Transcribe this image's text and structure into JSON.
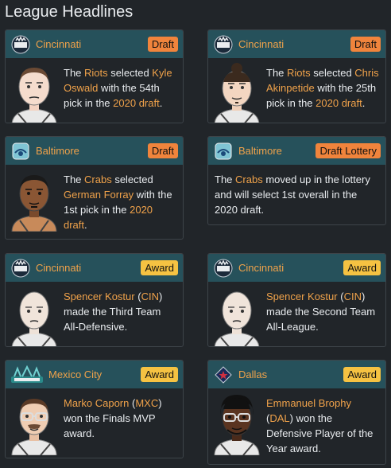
{
  "page": {
    "title": "League Headlines"
  },
  "cards": [
    {
      "team": "Cincinnati",
      "badge": "Draft",
      "badge_type": "draft",
      "logo": "riots-logo",
      "parts": [
        "The ",
        "Riots",
        " selected ",
        "Kyle Oswald",
        " with the 54th pick in the ",
        "2020 draft",
        "."
      ]
    },
    {
      "team": "Cincinnati",
      "badge": "Draft",
      "badge_type": "draft",
      "logo": "riots-logo",
      "parts": [
        "The ",
        "Riots",
        " selected ",
        "Chris Akinpetide",
        " with the 25th pick in the ",
        "2020 draft",
        "."
      ]
    },
    {
      "team": "Baltimore",
      "badge": "Draft",
      "badge_type": "draft",
      "logo": "crabs-logo",
      "parts": [
        "The ",
        "Crabs",
        " selected ",
        "German Forray",
        " with the 1st pick in the ",
        "2020 draft",
        "."
      ]
    },
    {
      "team": "Baltimore",
      "badge": "Draft Lottery",
      "badge_type": "draft",
      "logo": "crabs-logo",
      "parts": [
        "The ",
        "Crabs",
        " moved up in the lottery and will select 1st overall in the 2020 draft."
      ]
    },
    {
      "team": "Cincinnati",
      "badge": "Award",
      "badge_type": "award",
      "logo": "riots-logo",
      "parts": [
        "Spencer Kostur",
        " (",
        "CIN",
        ") made the Third Team All-Defensive."
      ]
    },
    {
      "team": "Cincinnati",
      "badge": "Award",
      "badge_type": "award",
      "logo": "riots-logo",
      "parts": [
        "Spencer Kostur",
        " (",
        "CIN",
        ") made the Second Team All-League."
      ]
    },
    {
      "team": "Mexico City",
      "badge": "Award",
      "badge_type": "award",
      "logo": "aztecs-logo",
      "parts": [
        "Marko Caporn",
        " (",
        "MXC",
        ") won the Finals MVP award."
      ]
    },
    {
      "team": "Dallas",
      "badge": "Award",
      "badge_type": "award",
      "logo": "dallas-logo",
      "parts": [
        "Emmanuel Brophy",
        " (",
        "DAL",
        ") won the Defensive Player of the Year award."
      ]
    }
  ],
  "colors": {
    "background": "#212529",
    "header": "#26515b",
    "link": "#f0a24a",
    "draft_badge": "#f0843c",
    "award_badge": "#f5c242"
  }
}
